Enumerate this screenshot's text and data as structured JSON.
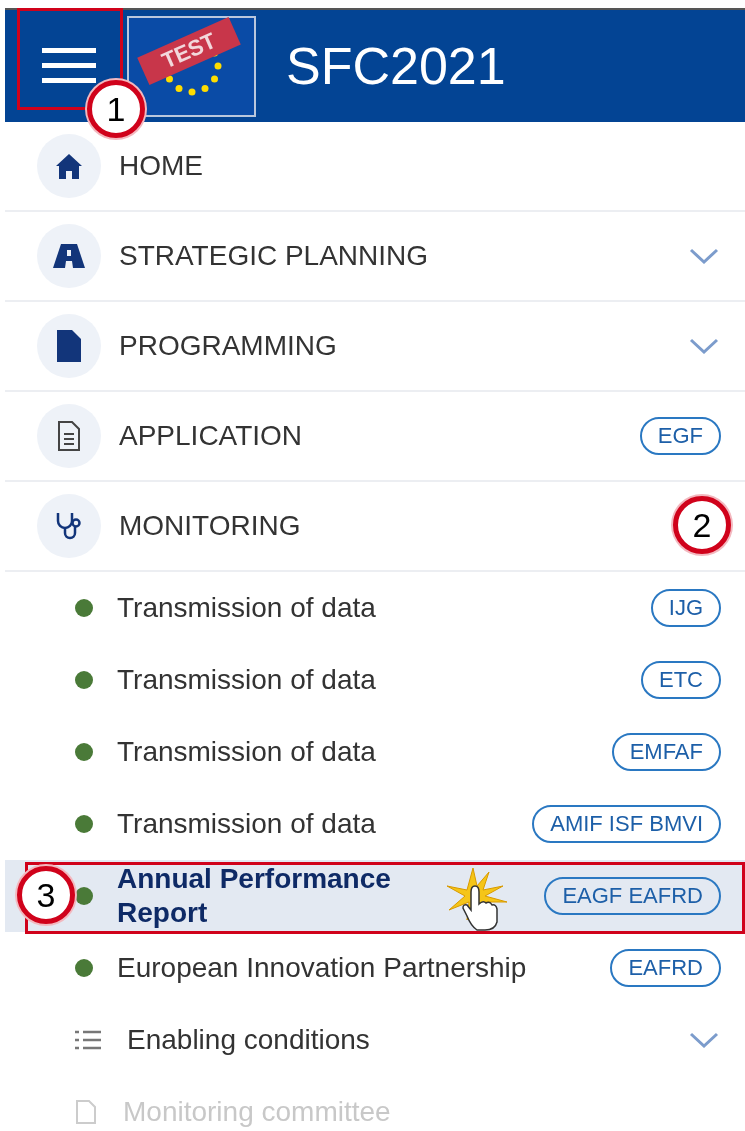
{
  "header": {
    "title": "SFC2021",
    "test_label": "TEST",
    "callout": "1"
  },
  "menu": [
    {
      "label": "HOME"
    },
    {
      "label": "STRATEGIC PLANNING",
      "expanded": false
    },
    {
      "label": "PROGRAMMING",
      "expanded": false
    },
    {
      "label": "APPLICATION",
      "badge": "EGF"
    },
    {
      "label": "MONITORING",
      "expanded": true,
      "callout": "2",
      "children": [
        {
          "kind": "item",
          "label": "Transmission of data",
          "badge": "IJG",
          "selected": false
        },
        {
          "kind": "item",
          "label": "Transmission of data",
          "badge": "ETC",
          "selected": false
        },
        {
          "kind": "item",
          "label": "Transmission of data",
          "badge": "EMFAF",
          "selected": false
        },
        {
          "kind": "item",
          "label": "Transmission of data",
          "badge": "AMIF ISF BMVI",
          "selected": false
        },
        {
          "kind": "item",
          "label": "Annual Performance Report",
          "badge": "EAGF EAFRD",
          "selected": true,
          "callout": "3"
        },
        {
          "kind": "item",
          "label": "European Innovation Partnership",
          "badge": "EAFRD",
          "selected": false
        },
        {
          "kind": "group",
          "label": "Enabling conditions",
          "expanded": false
        },
        {
          "kind": "page",
          "label": "Monitoring committee",
          "disabled": true
        }
      ]
    }
  ]
}
